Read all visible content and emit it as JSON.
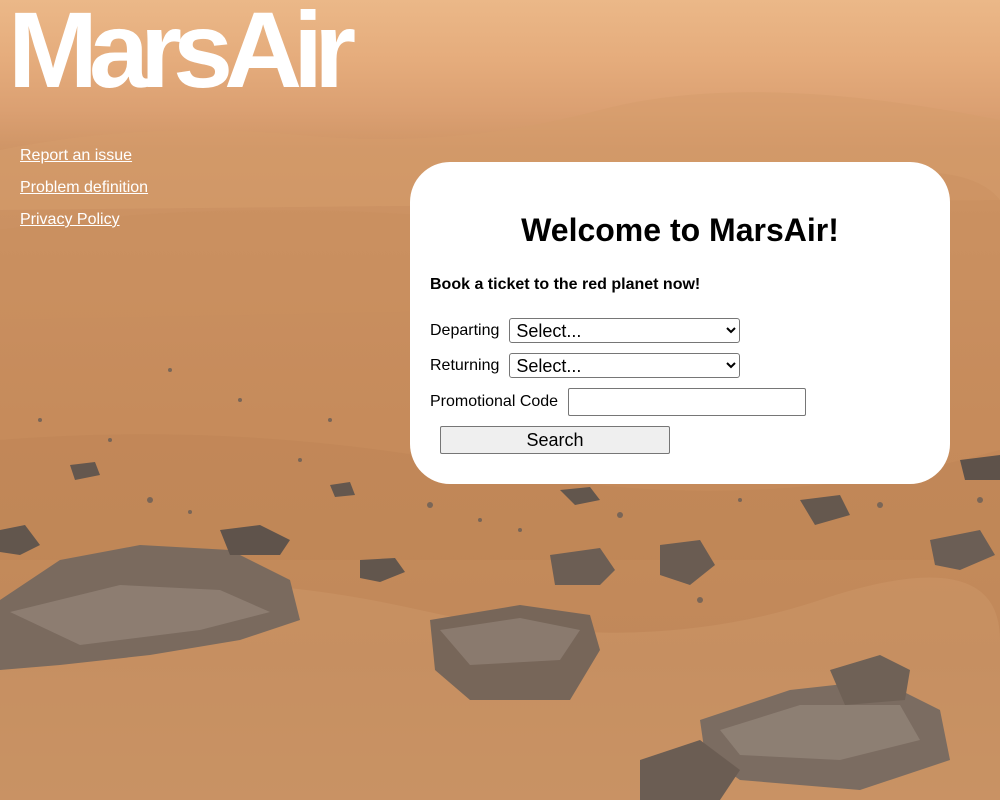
{
  "site": {
    "logo_text": "MarsAir"
  },
  "nav": {
    "links": [
      {
        "label": "Report an issue"
      },
      {
        "label": "Problem definition"
      },
      {
        "label": "Privacy Policy"
      }
    ]
  },
  "booking": {
    "heading": "Welcome to MarsAir!",
    "tagline": "Book a ticket to the red planet now!",
    "departing_label": "Departing",
    "departing_value": "Select...",
    "returning_label": "Returning",
    "returning_value": "Select...",
    "promo_label": "Promotional Code",
    "promo_value": "",
    "search_label": "Search"
  },
  "colors": {
    "link_text": "#ffffff",
    "panel_bg": "#ffffff",
    "sky": "#ebb888",
    "ground": "#c48a5a"
  }
}
